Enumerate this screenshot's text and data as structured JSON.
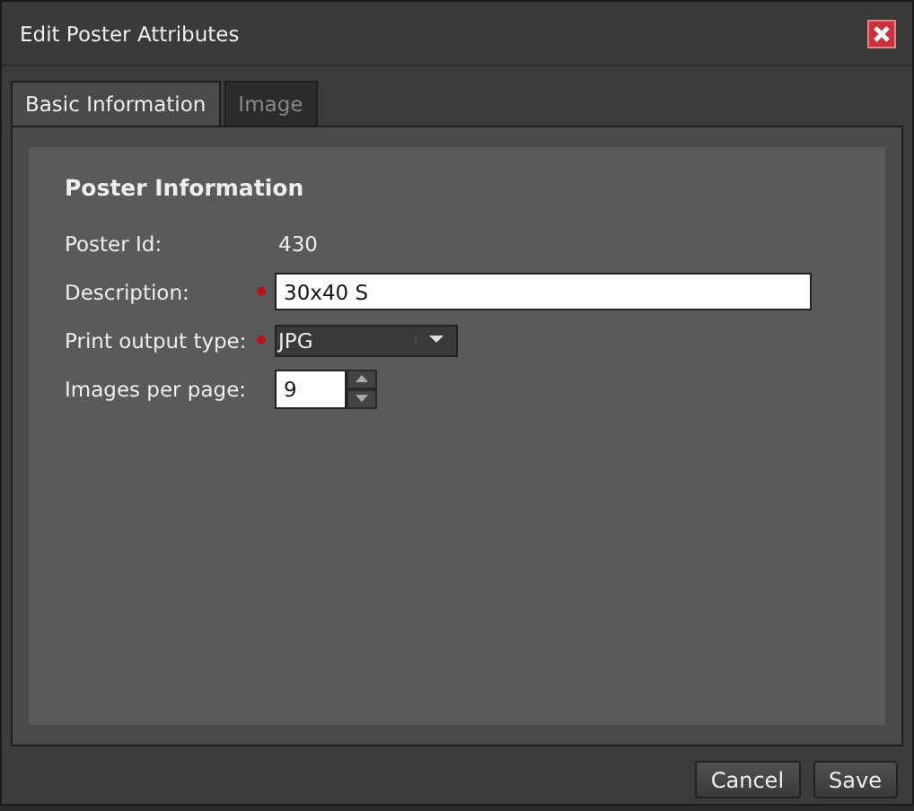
{
  "window": {
    "title": "Edit Poster Attributes"
  },
  "tabs": [
    {
      "label": "Basic Information",
      "selected": true
    },
    {
      "label": "Image",
      "selected": false
    }
  ],
  "section": {
    "title": "Poster Information"
  },
  "fields": [
    {
      "kind": "static",
      "label": "Poster Id:",
      "value": "430",
      "required": false
    },
    {
      "kind": "text",
      "label": "Description:",
      "value": "30x40 S",
      "required": true
    },
    {
      "kind": "select",
      "label": "Print output type:",
      "value": "JPG",
      "required": true
    },
    {
      "kind": "number",
      "label": "Images per page:",
      "value": "9",
      "required": false
    }
  ],
  "buttons": [
    "Cancel",
    "Save"
  ]
}
